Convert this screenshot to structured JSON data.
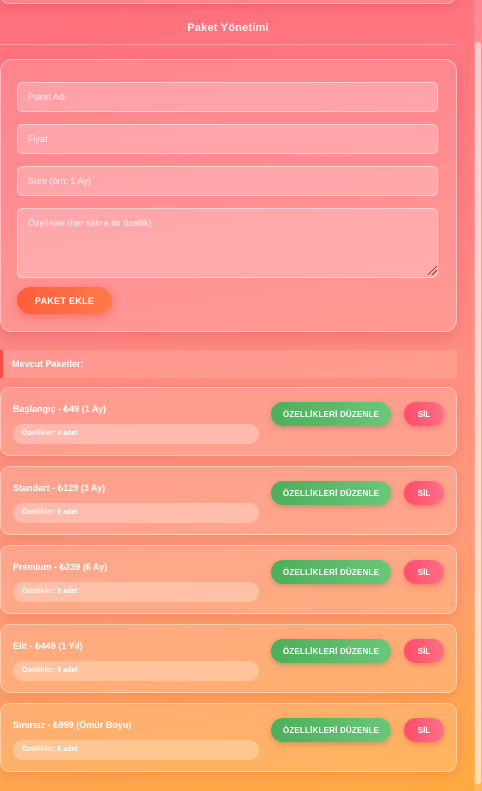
{
  "section": {
    "title": "Paket Yönetimi"
  },
  "form": {
    "name_placeholder": "Paket Adı",
    "price_placeholder": "Fiyat",
    "duration_placeholder": "Süre (örn: 1 Ay)",
    "features_placeholder": "Özellikler (her satıra bir özellik)",
    "add_button": "PAKET EKLE"
  },
  "list": {
    "header": "Mevcut Paketler:",
    "packages": [
      {
        "title": "Başlangıç - ₺49 (1 Ay)",
        "features": "Özellikler: 4 adet",
        "edit": "ÖZELLİKLERİ DÜZENLE",
        "delete": "SİL"
      },
      {
        "title": "Standart - ₺129 (3 Ay)",
        "features": "Özellikler: 5 adet",
        "edit": "ÖZELLİKLERİ DÜZENLE",
        "delete": "SİL"
      },
      {
        "title": "Premium - ₺239 (6 Ay)",
        "features": "Özellikler: 5 adet",
        "edit": "ÖZELLİKLERİ DÜZENLE",
        "delete": "SİL"
      },
      {
        "title": "Elit - ₺449 (1 Yıl)",
        "features": "Özellikler: 5 adet",
        "edit": "ÖZELLİKLERİ DÜZENLE",
        "delete": "SİL"
      },
      {
        "title": "Sınırsız - ₺999 (Ömür Boyu)",
        "features": "Özellikler: 6 adet",
        "edit": "ÖZELLİKLERİ DÜZENLE",
        "delete": "SİL"
      }
    ]
  },
  "colors": {
    "edit_button": "#4cae5a",
    "delete_button": "#ff4d6a",
    "add_button": "#ff5d3a"
  }
}
